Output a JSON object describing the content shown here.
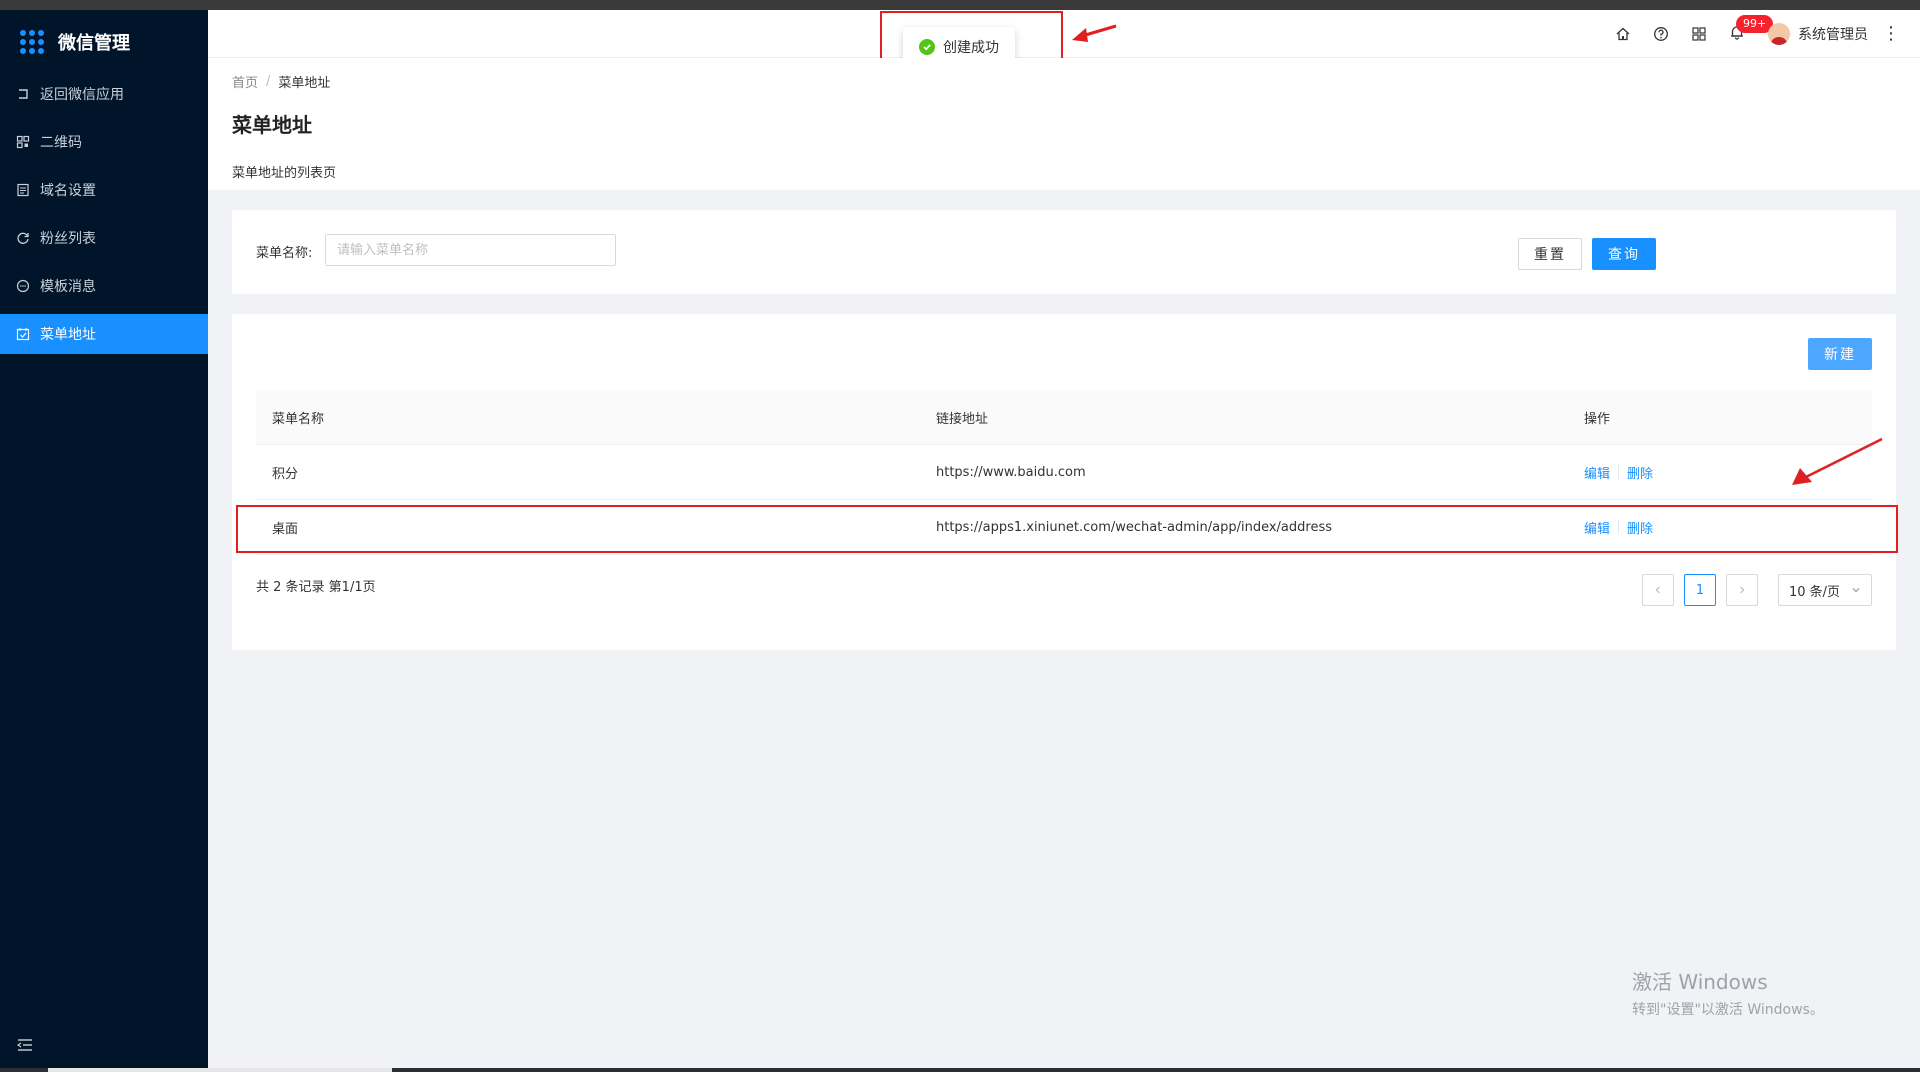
{
  "app": {
    "title": "微信管理"
  },
  "sidebar": {
    "items": [
      {
        "label": "返回微信应用",
        "icon": "return-icon",
        "active": false
      },
      {
        "label": "二维码",
        "icon": "qrcode-icon",
        "active": false
      },
      {
        "label": "域名设置",
        "icon": "document-icon",
        "active": false
      },
      {
        "label": "粉丝列表",
        "icon": "refresh-icon",
        "active": false
      },
      {
        "label": "模板消息",
        "icon": "message-icon",
        "active": false
      },
      {
        "label": "菜单地址",
        "icon": "calendar-check-icon",
        "active": true
      }
    ]
  },
  "header": {
    "badge": "99+",
    "user": "系统管理员"
  },
  "toast": {
    "message": "创建成功"
  },
  "page": {
    "breadcrumb": [
      "首页",
      "菜单地址"
    ],
    "title": "菜单地址",
    "description": "菜单地址的列表页"
  },
  "search": {
    "label": "菜单名称:",
    "placeholder": "请输入菜单名称",
    "reset": "重置",
    "query": "查询"
  },
  "table": {
    "new_button": "新建",
    "columns": [
      "菜单名称",
      "链接地址",
      "操作"
    ],
    "rows": [
      {
        "name": "积分",
        "url": "https://www.baidu.com",
        "edit": "编辑",
        "delete": "删除"
      },
      {
        "name": "桌面",
        "url": "https://apps1.xiniunet.com/wechat-admin/app/index/address",
        "edit": "编辑",
        "delete": "删除"
      }
    ],
    "total": "共 2 条记录 第1/1页",
    "pagination": {
      "current": "1",
      "page_size": "10 条/页"
    }
  },
  "watermark": {
    "line1": "激活 Windows",
    "line2": "转到\"设置\"以激活 Windows。"
  },
  "colors": {
    "accent": "#1890ff",
    "sidebar": "#001529",
    "success": "#52c41a",
    "annotation": "#e02020"
  }
}
